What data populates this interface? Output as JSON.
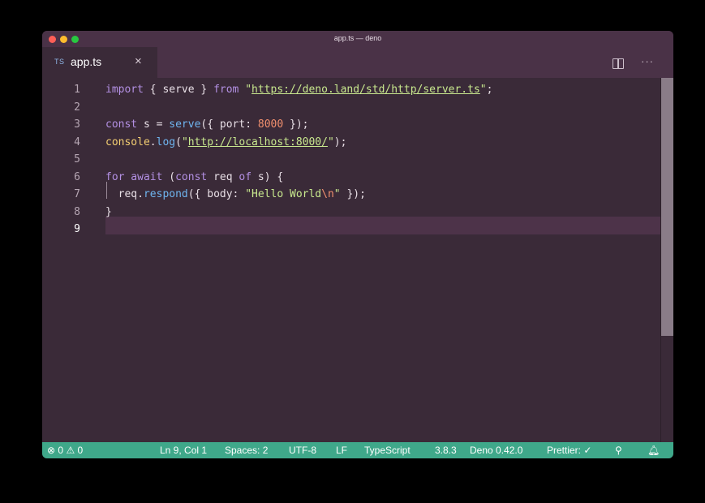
{
  "window": {
    "title": "app.ts — deno"
  },
  "tab": {
    "lang_badge": "TS",
    "filename": "app.ts",
    "close_glyph": "×"
  },
  "toolbar": {
    "split_icon": "split-editor-icon",
    "more_glyph": "···"
  },
  "editor": {
    "line_numbers": [
      "1",
      "2",
      "3",
      "4",
      "5",
      "6",
      "7",
      "8",
      "9"
    ],
    "active_line": "9",
    "lines": [
      [
        {
          "c": "kw",
          "t": "import"
        },
        {
          "c": "plain",
          "t": " { serve } "
        },
        {
          "c": "kw",
          "t": "from"
        },
        {
          "c": "plain",
          "t": " "
        },
        {
          "c": "str",
          "t": "\""
        },
        {
          "c": "str url",
          "t": "https://deno.land/std/http/server.ts"
        },
        {
          "c": "str",
          "t": "\""
        },
        {
          "c": "plain",
          "t": ";"
        }
      ],
      [],
      [
        {
          "c": "kw",
          "t": "const"
        },
        {
          "c": "plain",
          "t": " s = "
        },
        {
          "c": "fn",
          "t": "serve"
        },
        {
          "c": "plain",
          "t": "({ port: "
        },
        {
          "c": "num",
          "t": "8000"
        },
        {
          "c": "plain",
          "t": " });"
        }
      ],
      [
        {
          "c": "obj",
          "t": "console"
        },
        {
          "c": "plain",
          "t": "."
        },
        {
          "c": "fn",
          "t": "log"
        },
        {
          "c": "plain",
          "t": "("
        },
        {
          "c": "str",
          "t": "\""
        },
        {
          "c": "str url",
          "t": "http://localhost:8000/"
        },
        {
          "c": "str",
          "t": "\""
        },
        {
          "c": "plain",
          "t": ");"
        }
      ],
      [],
      [
        {
          "c": "kw",
          "t": "for await"
        },
        {
          "c": "plain",
          "t": " ("
        },
        {
          "c": "kw",
          "t": "const"
        },
        {
          "c": "plain",
          "t": " req "
        },
        {
          "c": "kw",
          "t": "of"
        },
        {
          "c": "plain",
          "t": " s) {"
        }
      ],
      [
        {
          "c": "plain",
          "t": "  req."
        },
        {
          "c": "fn",
          "t": "respond"
        },
        {
          "c": "plain",
          "t": "({ body: "
        },
        {
          "c": "str",
          "t": "\"Hello World"
        },
        {
          "c": "esc",
          "t": "\\n"
        },
        {
          "c": "str",
          "t": "\""
        },
        {
          "c": "plain",
          "t": " });"
        }
      ],
      [
        {
          "c": "plain",
          "t": "}"
        }
      ],
      []
    ]
  },
  "statusbar": {
    "errors_icon": "error-circle-icon",
    "errors": "0",
    "warnings_icon": "warning-triangle-icon",
    "warnings": "0",
    "position": "Ln 9, Col 1",
    "spaces": "Spaces: 2",
    "encoding": "UTF-8",
    "eol": "LF",
    "language": "TypeScript",
    "ts_version": "3.8.3",
    "deno_version": "Deno 0.42.0",
    "prettier": "Prettier: ✓",
    "feedback_icon": "feedback-person-icon",
    "bell_icon": "bell-icon"
  },
  "colors": {
    "statusbar_bg": "#3fa88a",
    "editor_bg": "#3a2a38",
    "tabbar_bg": "#4a3247"
  }
}
